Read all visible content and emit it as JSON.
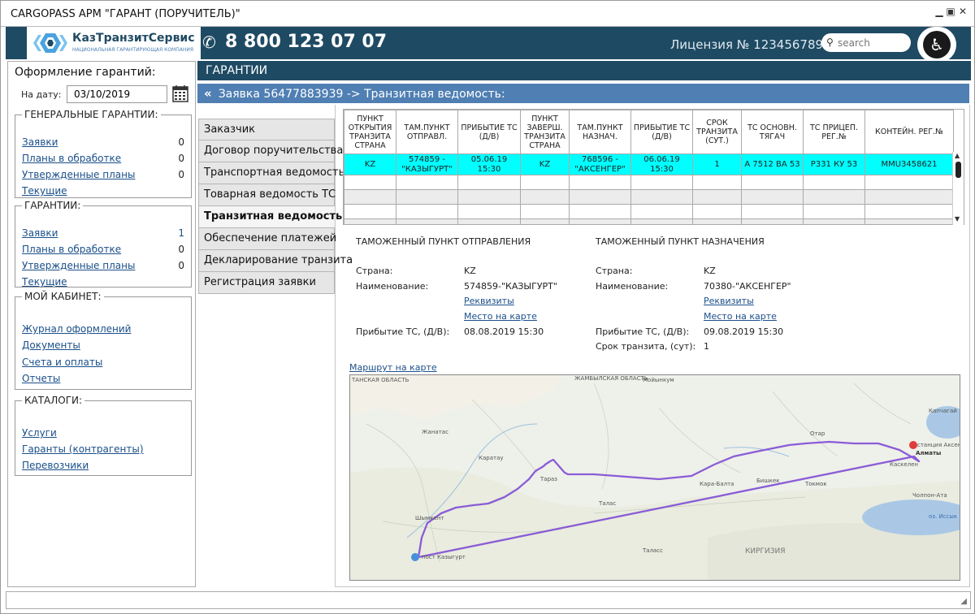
{
  "window": {
    "title": "CARGOPASS АРМ \"ГАРАНТ (ПОРУЧИТЕЛЬ)\"",
    "min_icon": "minimize-icon",
    "max_icon": "maximize-icon",
    "close_icon": "close-icon"
  },
  "header": {
    "logo_name": "КазТранзитСервис",
    "logo_subtitle": "НАЦИОНАЛЬНАЯ ГАРАНТИРУЮЩАЯ КОМПАНИЯ",
    "phone": "8 800 123 07 07",
    "license": "Лицензия № 123456789",
    "search_placeholder": "search",
    "bg_color": "#1f4a63"
  },
  "sidebar": {
    "title": "Оформление гарантий:",
    "date_label": "На дату:",
    "date_value": "03/10/2019",
    "groups": [
      {
        "legend": "ГЕНЕРАЛЬНЫЕ ГАРАНТИИ:",
        "items": [
          {
            "label": "Заявки",
            "count": "0"
          },
          {
            "label": "Планы в обработке",
            "count": "0"
          },
          {
            "label": "Утвержденные планы",
            "count": "0"
          },
          {
            "label": "Текущие",
            "count": ""
          }
        ]
      },
      {
        "legend": "ГАРАНТИИ:",
        "items": [
          {
            "label": "Заявки",
            "count": "1"
          },
          {
            "label": "Планы в обработке",
            "count": "0"
          },
          {
            "label": "Утвержденные планы",
            "count": "0"
          },
          {
            "label": "Текущие",
            "count": ""
          }
        ]
      },
      {
        "legend": "МОЙ КАБИНЕТ:",
        "items": [
          {
            "label": "Журнал оформлений"
          },
          {
            "label": "Документы"
          },
          {
            "label": "Счета и оплаты"
          },
          {
            "label": "Отчеты"
          }
        ]
      },
      {
        "legend": "КАТАЛОГИ:",
        "items": [
          {
            "label": "Услуги"
          },
          {
            "label": "Гаранты (контрагенты)"
          },
          {
            "label": "Перевозчики"
          }
        ]
      }
    ]
  },
  "main": {
    "header": "ГАРАНТИИ",
    "breadcrumb": "Заявка 56477883939 -> Транзитная ведомость:",
    "tabs": [
      {
        "label": "Заказчик"
      },
      {
        "label": "Договор поручительства"
      },
      {
        "label": "Транспортная ведомость"
      },
      {
        "label": "Товарная ведомость ТС"
      },
      {
        "label": "Транзитная ведомость"
      },
      {
        "label": "Обеспечение платежей"
      },
      {
        "label": "Декларирование транзита"
      },
      {
        "label": "Регистрация заявки"
      }
    ],
    "active_tab": "Транзитная ведомость"
  },
  "table": {
    "columns": [
      "ПУНКТ ОТКРЫТИЯ ТРАНЗИТА СТРАНА",
      "ТАМ.ПУНКТ ОТПРАВЛ.",
      "ПРИБЫТИЕ ТС (Д/В)",
      "ПУНКТ ЗАВЕРШ. ТРАНЗИТА СТРАНА",
      "ТАМ.ПУНКТ НАЗНАЧ.",
      "ПРИБЫТИЕ ТС (Д/В)",
      "СРОК ТРАНЗИТА (СУТ.)",
      "ТС ОСНОВН. ТЯГАЧ",
      "ТС ПРИЦЕП. РЕГ.№",
      "КОНТЕЙН. РЕГ.№"
    ],
    "rows": [
      [
        "KZ",
        "574859 - \"КАЗЫГУРТ\"",
        "05.06.19 15:30",
        "KZ",
        "768596 - \"АКСЕНГЕР\"",
        "06.06.19 15:30",
        "1",
        "А 7512 ВА 53",
        "Р331 КУ 53",
        "ММU3458621"
      ]
    ],
    "highlight_color": "#00ffff"
  },
  "details": {
    "origin": {
      "title": "ТАМОЖЕННЫЙ ПУНКТ ОТПРАВЛЕНИЯ",
      "country_label": "Страна:",
      "country": "KZ",
      "name_label": "Наименование:",
      "name": "574859-\"КАЗЫГУРТ\"",
      "requisites_link": "Реквизиты",
      "map_link": "Место на карте",
      "arrival_label": "Прибытие ТС, (Д/В):",
      "arrival": "08.08.2019 15:30"
    },
    "destination": {
      "title": "ТАМОЖЕННЫЙ ПУНКТ НАЗНАЧЕНИЯ",
      "country_label": "Страна:",
      "country": "KZ",
      "name_label": "Наименование:",
      "name": "70380-\"АКСЕНГЕР\"",
      "requisites_link": "Реквизиты",
      "map_link": "Место на карте",
      "arrival_label": "Прибытие ТС, (Д/В):",
      "arrival": "09.08.2019 15:30",
      "transit_label": "Срок транзита, (сут):",
      "transit": "1"
    },
    "route_link": "Маршрут на карте"
  },
  "map": {
    "labels": {
      "region": "ТАНСКАЯ ОБЛАСТЬ",
      "zhambyl": "ЖАМБЫЛСКАЯ ОБЛАСТЬ",
      "moyynkum": "Мойынкум",
      "zhanatas": "Жанатас",
      "karatau": "Каратау",
      "taraz": "Тараз",
      "shymkent": "Шымкент",
      "talas": "Талас",
      "kara_balta": "Кара-Балта",
      "bishkek": "Бишкек",
      "tokmok": "Токмок",
      "kyrgyzstan": "КИРГИЗИЯ",
      "almaty": "Алматы",
      "aksenger": "станция Аксенгер",
      "kazygurt": "пост Казыгурт",
      "kaskelen": "Каскелен",
      "issyk": "оз. Иссык",
      "cholpon": "Чолпон-Ата",
      "kapshagai": "Капчагай",
      "otar": "Отар",
      "talas2": "Таласс"
    },
    "route_color": "#8a5cd6"
  }
}
